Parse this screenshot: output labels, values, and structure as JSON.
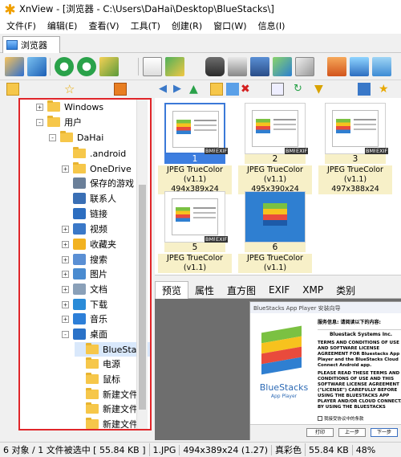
{
  "window": {
    "title": "XnView - [浏览器 - C:\\Users\\DaHai\\Desktop\\BlueStacks\\]"
  },
  "menu": [
    "文件(F)",
    "编辑(E)",
    "查看(V)",
    "工具(T)",
    "创建(R)",
    "窗口(W)",
    "信息(I)"
  ],
  "tab": {
    "label": "浏览器"
  },
  "tree": {
    "items": [
      {
        "label": "Windows",
        "kind": "folder"
      },
      {
        "label": "用户",
        "kind": "folder"
      },
      {
        "label": "DaHai",
        "kind": "folder"
      },
      {
        "label": ".android",
        "kind": "folder"
      },
      {
        "label": "OneDrive",
        "kind": "folder"
      },
      {
        "label": "保存的游戏",
        "kind": "special"
      },
      {
        "label": "联系人",
        "kind": "special"
      },
      {
        "label": "链接",
        "kind": "special"
      },
      {
        "label": "视频",
        "kind": "special"
      },
      {
        "label": "收藏夹",
        "kind": "special"
      },
      {
        "label": "搜索",
        "kind": "special"
      },
      {
        "label": "图片",
        "kind": "special"
      },
      {
        "label": "文档",
        "kind": "special"
      },
      {
        "label": "下载",
        "kind": "special"
      },
      {
        "label": "音乐",
        "kind": "special"
      },
      {
        "label": "桌面",
        "kind": "special"
      },
      {
        "label": "BlueSta",
        "kind": "folder"
      },
      {
        "label": "电源",
        "kind": "folder"
      },
      {
        "label": "鼠标",
        "kind": "folder"
      },
      {
        "label": "新建文件",
        "kind": "folder"
      },
      {
        "label": "新建文件",
        "kind": "folder"
      },
      {
        "label": "新建文件",
        "kind": "folder"
      }
    ]
  },
  "thumbnails": [
    {
      "num": "1",
      "type": "JPEG TrueColor (v1.1)",
      "dims": "494x389x24"
    },
    {
      "num": "2",
      "type": "JPEG TrueColor (v1.1)",
      "dims": "495x390x24"
    },
    {
      "num": "3",
      "type": "JPEG TrueColor (v1.1)",
      "dims": "497x388x24"
    },
    {
      "num": "5",
      "type": "JPEG TrueColor (v1.1)",
      "dims": ""
    },
    {
      "num": "6",
      "type": "JPEG TrueColor (v1.1)",
      "dims": ""
    }
  ],
  "badges": {
    "bmp": "BMP",
    "exif": "EXIF"
  },
  "preview_tabs": [
    "预览",
    "属性",
    "直方图",
    "EXIF",
    "XMP",
    "类别"
  ],
  "preview": {
    "dialog_title": "BlueStacks App Player 安装向导",
    "heading": "服务信息: 请阅读以下的内容:",
    "company": "Bluestack Systems Inc.",
    "para1": "TERMS AND CONDITIONS OF USE AND SOFTWARE LICENSE AGREEMENT FOR Bluestacks App Player and the BlueStacks Cloud Connect Android app.",
    "para2": "PLEASE READ THESE TERMS AND CONDITIONS OF USE AND THIS SOFTWARE LICENSE AGREEMENT (\"LICENSE\") CAREFULLY BEFORE USING THE BLUESTACKS APP PLAYER AND/OR CLOUD CONNECT. BY USING THE BLUESTACKS",
    "logo_text": "BlueStacks",
    "logo_sub": "App Player",
    "checkbox": "我接受协议中的条款",
    "btn_print": "打印",
    "btn_back": "上一步",
    "btn_next": "下一步"
  },
  "status": [
    "6 对象 / 1 文件被选中 [ 55.84 KB ]",
    "1.JPG",
    "494x389x24 (1.27)",
    "真彩色",
    "55.84 KB",
    "48%"
  ]
}
